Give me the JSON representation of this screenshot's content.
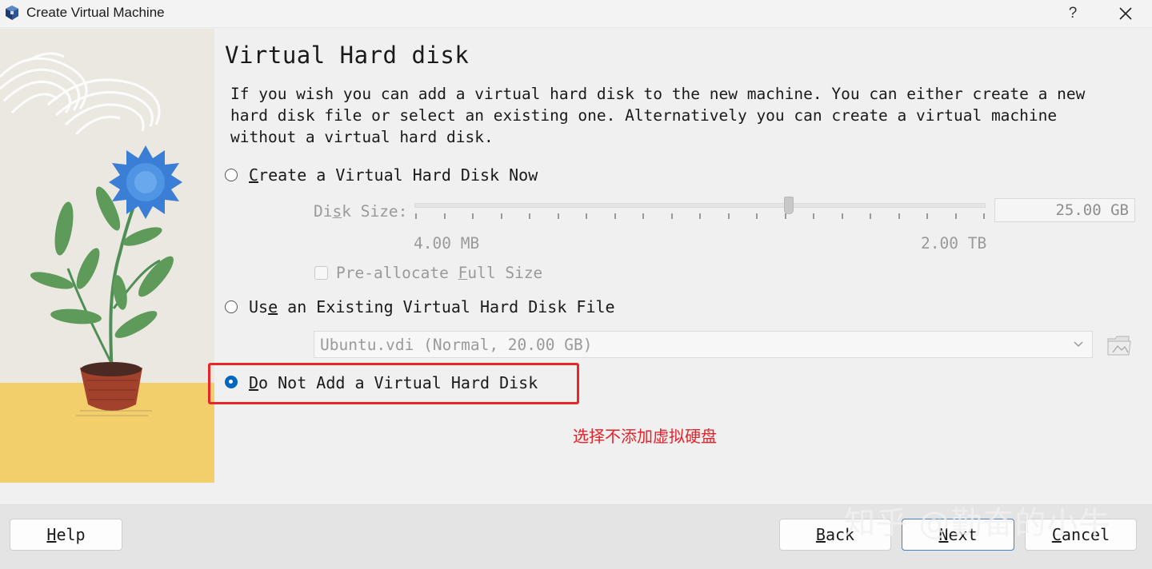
{
  "window": {
    "title": "Create Virtual Machine",
    "help_glyph": "?",
    "close_icon": "close-icon",
    "app_icon": "virtualbox-icon"
  },
  "page": {
    "title": "Virtual Hard disk",
    "description": "If you wish you can add a virtual hard disk to the new machine. You can either create a new hard disk file or select an existing one. Alternatively you can create a virtual machine without a virtual hard disk."
  },
  "options": {
    "create_now": {
      "label_pre": "",
      "label_u": "C",
      "label_post": "reate a Virtual Hard Disk Now",
      "selected": false
    },
    "use_existing": {
      "label_pre": "Us",
      "label_u": "e",
      "label_post": " an Existing Virtual Hard Disk File",
      "selected": false
    },
    "do_not_add": {
      "label_pre": "",
      "label_u": "D",
      "label_post": "o Not Add a Virtual Hard Disk",
      "selected": true
    }
  },
  "disk_size": {
    "label_pre": "Di",
    "label_u": "s",
    "label_post": "k Size:",
    "value_text": "25.00 GB",
    "min_label": "4.00 MB",
    "max_label": "2.00 TB",
    "slider_fraction": 0.656
  },
  "preallocate": {
    "label_pre": "Pre-allocate ",
    "label_u": "F",
    "label_post": "ull Size",
    "checked": false
  },
  "existing_disk": {
    "selected_value": "Ubuntu.vdi (Normal, 20.00 GB)",
    "chevron_icon": "chevron-down-icon",
    "folder_icon": "folder-icon"
  },
  "annotation": "选择不添加虚拟硬盘",
  "footer": {
    "help": {
      "u": "H",
      "post": "elp"
    },
    "back": {
      "u": "B",
      "post": "ack"
    },
    "next": {
      "u": "N",
      "post": "ext"
    },
    "cancel": {
      "u": "C",
      "post": "ancel"
    }
  },
  "watermark": "知乎 @勤奋的小牛",
  "colors": {
    "accent": "#0067c0",
    "highlight": "#e8262a",
    "sand": "#f3cf6c",
    "flower": "#3a7fd5"
  }
}
